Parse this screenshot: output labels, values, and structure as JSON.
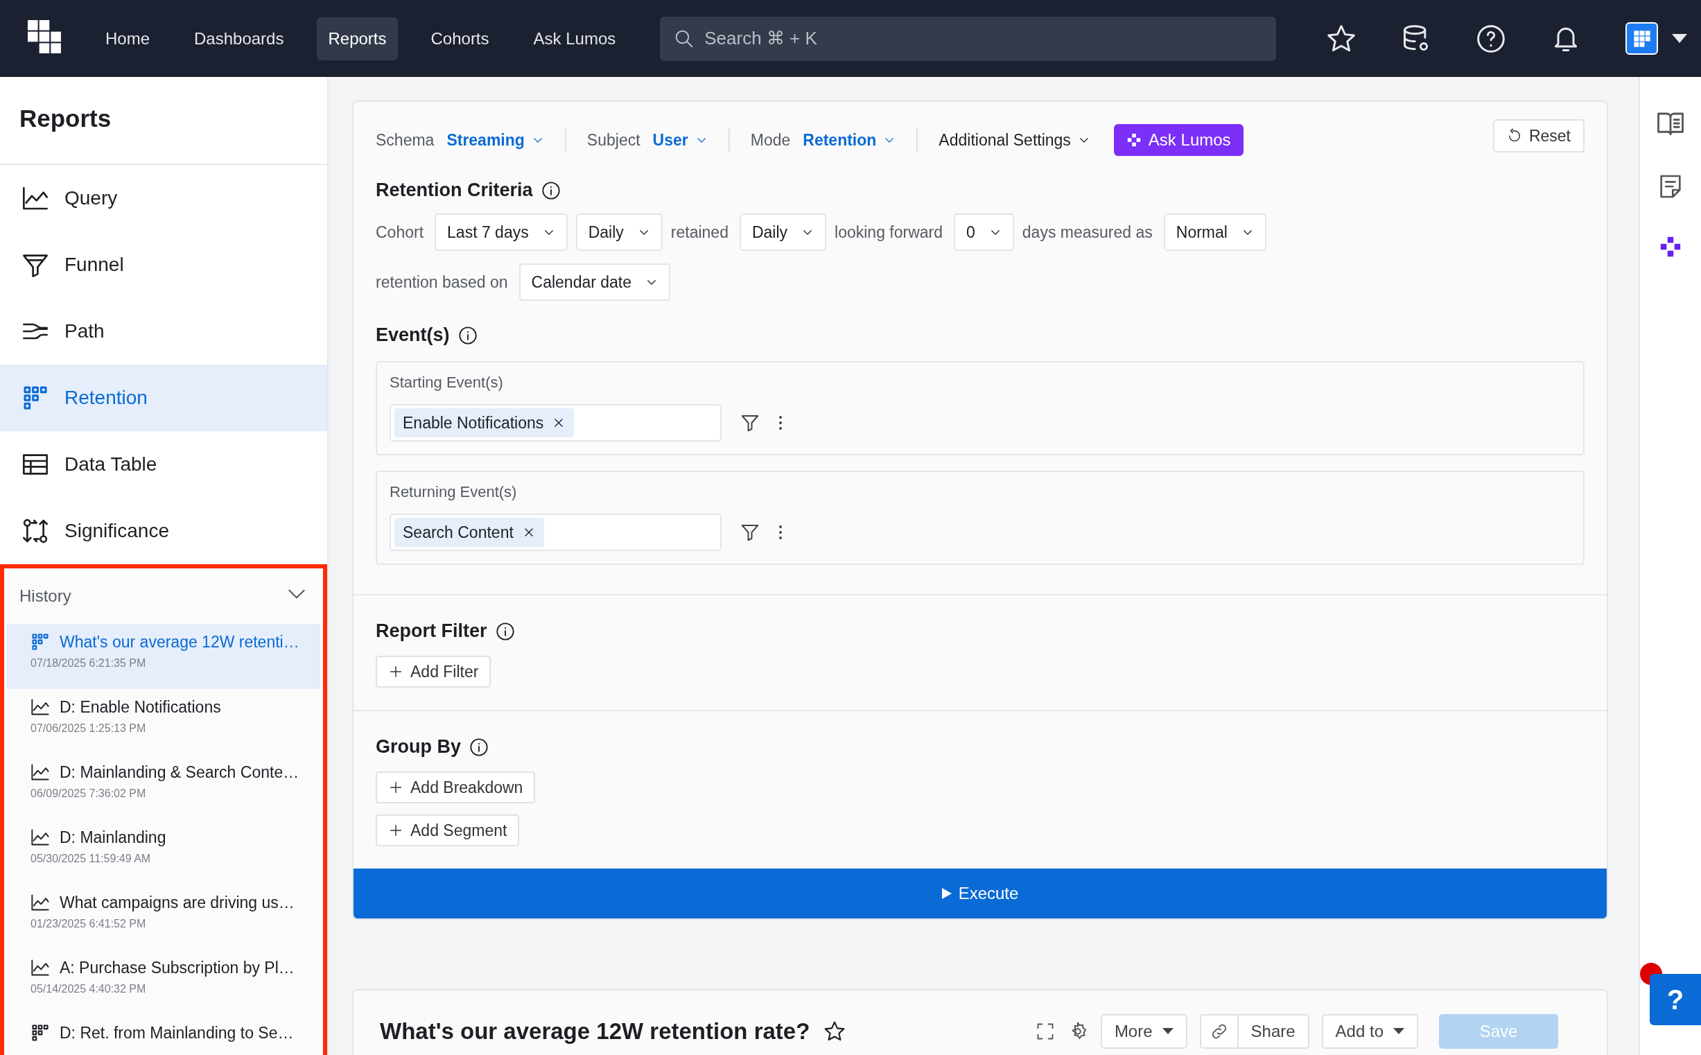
{
  "top_nav": {
    "items": [
      {
        "label": "Home",
        "selected": false
      },
      {
        "label": "Dashboards",
        "selected": false
      },
      {
        "label": "Reports",
        "selected": true
      },
      {
        "label": "Cohorts",
        "selected": false
      },
      {
        "label": "Ask Lumos",
        "selected": false
      }
    ],
    "search": {
      "placeholder": "Search ⌘ + K"
    }
  },
  "sidebar": {
    "title": "Reports",
    "items": [
      {
        "label": "Query",
        "selected": false
      },
      {
        "label": "Funnel",
        "selected": false
      },
      {
        "label": "Path",
        "selected": false
      },
      {
        "label": "Retention",
        "selected": true
      },
      {
        "label": "Data Table",
        "selected": false
      },
      {
        "label": "Significance",
        "selected": false
      }
    ]
  },
  "history": {
    "title": "History",
    "expanded": true,
    "items": [
      {
        "kind": "retention",
        "title": "What's our average 12W retenti…",
        "timestamp": "07/18/2025 6:21:35 PM",
        "selected": true
      },
      {
        "kind": "query",
        "title": "D: Enable Notifications",
        "timestamp": "07/06/2025 1:25:13 PM",
        "selected": false
      },
      {
        "kind": "query",
        "title": "D: Mainlanding & Search Conte…",
        "timestamp": "06/09/2025 7:36:02 PM",
        "selected": false
      },
      {
        "kind": "query",
        "title": "D: Mainlanding",
        "timestamp": "05/30/2025 11:59:49 AM",
        "selected": false
      },
      {
        "kind": "query",
        "title": "What campaigns are driving us…",
        "timestamp": "01/23/2025 6:41:52 PM",
        "selected": false
      },
      {
        "kind": "query",
        "title": "A: Purchase Subscription by Pl…",
        "timestamp": "05/14/2025 4:40:32 PM",
        "selected": false
      },
      {
        "kind": "retention",
        "title": "D: Ret. from Mainlanding to Se…",
        "selected": false
      }
    ]
  },
  "query_bar": {
    "fields": [
      {
        "label": "Schema",
        "value": "Streaming"
      },
      {
        "label": "Subject",
        "value": "User"
      },
      {
        "label": "Mode",
        "value": "Retention"
      }
    ],
    "additional_settings": "Additional Settings",
    "ask_button": "Ask Lumos",
    "reset_button": "Reset"
  },
  "retention_criteria": {
    "title": "Retention Criteria",
    "lines": [
      {
        "controls": [
          {
            "kind": "text",
            "text": "Cohort"
          },
          {
            "kind": "select",
            "value": "Last 7 days"
          },
          {
            "kind": "select",
            "value": "Daily"
          },
          {
            "kind": "text",
            "text": "retained"
          },
          {
            "kind": "select",
            "value": "Daily"
          },
          {
            "kind": "text",
            "text": "looking forward"
          },
          {
            "kind": "select",
            "value": "0"
          },
          {
            "kind": "text",
            "text": "days measured as"
          },
          {
            "kind": "select",
            "value": "Normal"
          }
        ]
      },
      {
        "controls": [
          {
            "kind": "text",
            "text": "retention based on"
          },
          {
            "kind": "select",
            "value": "Calendar date"
          }
        ]
      }
    ]
  },
  "events": {
    "title": "Event(s)",
    "groups": [
      {
        "label": "Starting Event(s)",
        "chips": [
          "Enable Notifications"
        ]
      },
      {
        "label": "Returning Event(s)",
        "chips": [
          "Search Content"
        ]
      }
    ]
  },
  "report_filter": {
    "title": "Report Filter",
    "buttons": [
      "Add Filter"
    ]
  },
  "group_by": {
    "title": "Group By",
    "buttons": [
      "Add Breakdown",
      "Add Segment"
    ]
  },
  "execute_button": "Execute",
  "help_button": "?",
  "report": {
    "title": "What's our average 12W retention rate?",
    "more": "More",
    "share": "Share",
    "add_to": "Add to",
    "save": {
      "label": "Save",
      "disabled": true
    }
  }
}
